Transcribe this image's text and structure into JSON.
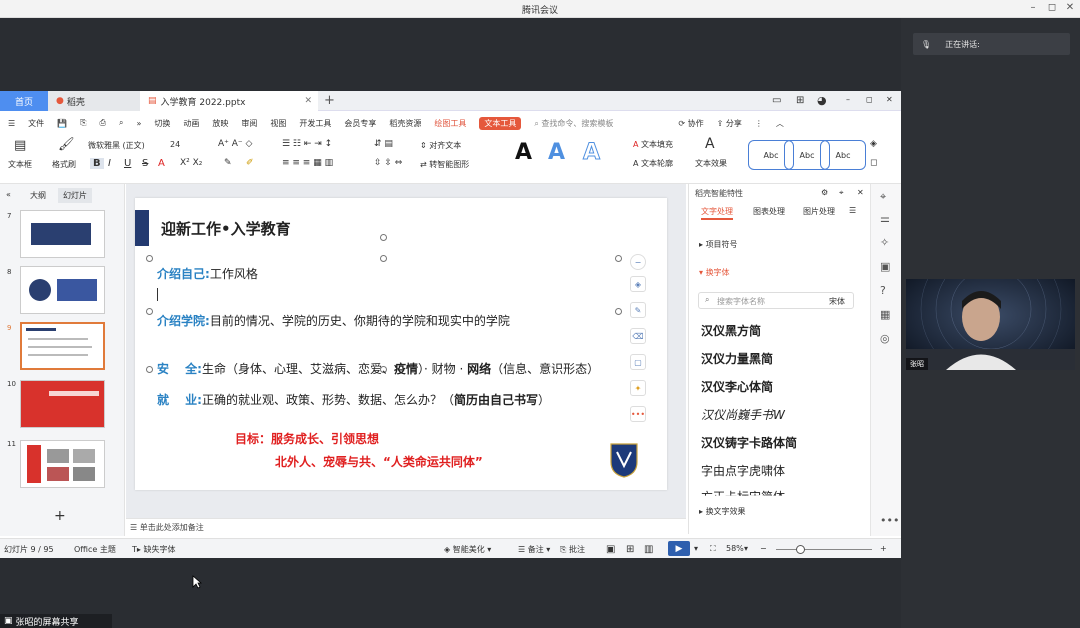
{
  "meeting": {
    "title": "腾讯会议",
    "speaking_label": "正在讲话:",
    "share_label": "张昭的屏幕共享",
    "participant_name": "张昭"
  },
  "wps": {
    "tabs": {
      "home": "首页",
      "daoke": "稻壳",
      "file": "入学教育 2022.pptx"
    },
    "menu": [
      "文件",
      "切换",
      "动画",
      "放映",
      "审阅",
      "视图",
      "开发工具",
      "会员专享",
      "稻壳资源",
      "绘图工具",
      "文本工具"
    ],
    "menu_search": "查找命令、搜索模板",
    "collab": "协作",
    "share": "分享",
    "ribbon": {
      "textbox": "文本框",
      "format_painter": "格式刷",
      "font_name": "微软雅黑 (正文)",
      "font_size": "24",
      "align_text": "对齐文本",
      "smart_shape": "转智能图形",
      "text_fill": "文本填充",
      "text_outline": "文本轮廓",
      "text_effect": "文本效果",
      "style_label": "Abc",
      "big_a": "A"
    },
    "thumbs": {
      "tabs": [
        "大纲",
        "幻灯片"
      ],
      "nums": [
        "7",
        "8",
        "9",
        "10",
        "11"
      ],
      "add": "+"
    },
    "slide": {
      "title": "迎新工作•入学教育",
      "line1_kw": "介绍自己:",
      "line1_txt": "工作风格",
      "line2_kw": "介绍学院:",
      "line2_txt": "目前的情况、学院的历史、你期待的学院和现实中的学院",
      "line3_kw": "安　 全:",
      "line3_a": "生命（身体、心理、艾滋病、恋爱、",
      "line3_b": "疫情",
      "line3_c": "）· 财物 · ",
      "line3_d": "网络",
      "line3_e": "（信息、意识形态）",
      "line4_kw": "就　 业:",
      "line4_a": "正确的就业观、政策、形势、数据、怎么办？（",
      "line4_b": "简历由自己书写",
      "line4_c": "）",
      "goal": "目标：服务成长、引领思想",
      "motto": "北外人、宠辱与共、“人类命运共同体”"
    },
    "notes_placeholder": "单击此处添加备注",
    "taskpane": {
      "head": "稻壳智能特性",
      "tabs": [
        "文字处理",
        "图表处理",
        "图片处理"
      ],
      "bullet": "项目符号",
      "replace_font": "换字体",
      "search_placeholder": "搜索字体名称",
      "current_font": "宋体",
      "fonts": [
        "汉仪黑方简",
        "汉仪力量黑简",
        "汉仪李心体简",
        "汉仪尚巍手书W",
        "汉仪铸字卡路体简",
        "字由点字虎啸体",
        "方正卡标宋简体"
      ],
      "text_effect": "换文字效果"
    },
    "status": {
      "slide_count": "幻灯片 9 / 95",
      "theme": "Office 主题",
      "missing_font": "缺失字体",
      "smart_beautify": "智能美化",
      "notes": "备注",
      "comments": "批注",
      "zoom": "58%",
      "minus": "−",
      "plus": "+"
    }
  }
}
